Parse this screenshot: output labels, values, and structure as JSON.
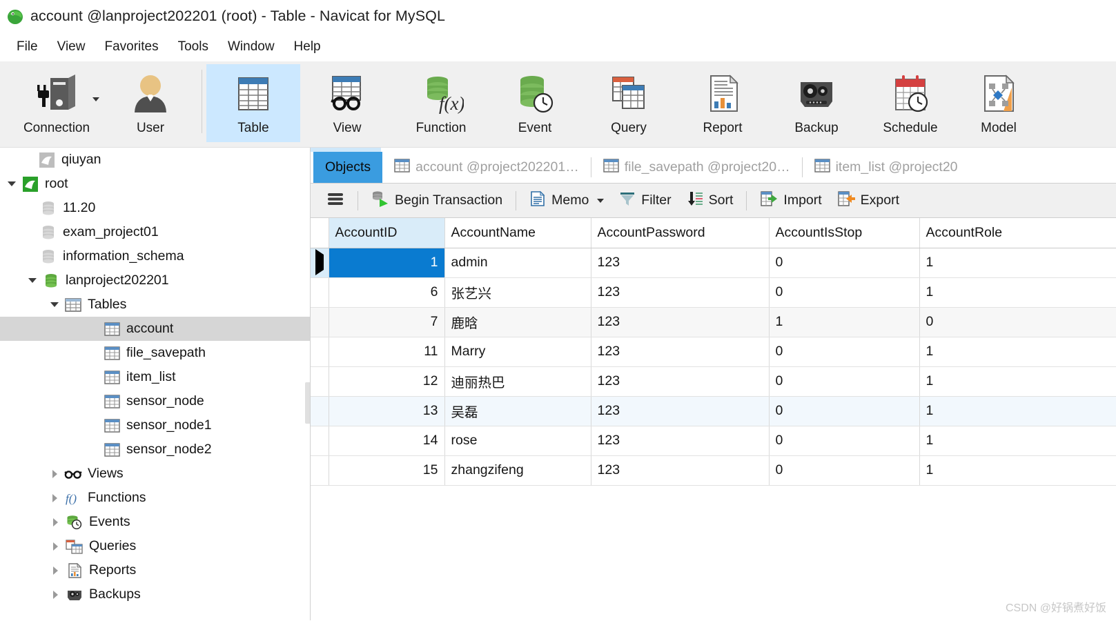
{
  "window": {
    "title": "account @lanproject202201 (root) - Table - Navicat for MySQL",
    "logo_icon": "navicat-dolphin-logo"
  },
  "menubar": {
    "items": [
      {
        "label": "File"
      },
      {
        "label": "View"
      },
      {
        "label": "Favorites"
      },
      {
        "label": "Tools"
      },
      {
        "label": "Window"
      },
      {
        "label": "Help"
      }
    ]
  },
  "ribbon": {
    "buttons": [
      {
        "label": "Connection",
        "icon": "connection-plug-icon",
        "has_dropdown": true,
        "active": false
      },
      {
        "label": "User",
        "icon": "user-icon",
        "has_dropdown": false,
        "active": false
      },
      {
        "label": "Table",
        "icon": "table-icon",
        "has_dropdown": false,
        "active": true
      },
      {
        "label": "View",
        "icon": "view-glasses-icon",
        "has_dropdown": false,
        "active": false
      },
      {
        "label": "Function",
        "icon": "function-fx-icon",
        "has_dropdown": false,
        "active": false
      },
      {
        "label": "Event",
        "icon": "event-clock-icon",
        "has_dropdown": false,
        "active": false
      },
      {
        "label": "Query",
        "icon": "query-icon",
        "has_dropdown": false,
        "active": false
      },
      {
        "label": "Report",
        "icon": "report-icon",
        "has_dropdown": false,
        "active": false
      },
      {
        "label": "Backup",
        "icon": "backup-tape-icon",
        "has_dropdown": false,
        "active": false
      },
      {
        "label": "Schedule",
        "icon": "schedule-calendar-icon",
        "has_dropdown": false,
        "active": false
      },
      {
        "label": "Model",
        "icon": "model-diagram-icon",
        "has_dropdown": false,
        "active": false
      }
    ]
  },
  "sidebar": {
    "nodes": [
      {
        "label": "qiuyan",
        "icon": "mysql-connection-gray-icon",
        "indent": 1,
        "twisty": "none",
        "selected": false
      },
      {
        "label": "root",
        "icon": "mysql-connection-green-icon",
        "indent": 0,
        "twisty": "down",
        "selected": false
      },
      {
        "label": "11.20",
        "icon": "database-gray-icon",
        "indent": 2,
        "twisty": "none",
        "selected": false
      },
      {
        "label": "exam_project01",
        "icon": "database-gray-icon",
        "indent": 2,
        "twisty": "none",
        "selected": false
      },
      {
        "label": "information_schema",
        "icon": "database-gray-icon",
        "indent": 2,
        "twisty": "none",
        "selected": false
      },
      {
        "label": "lanproject202201",
        "icon": "database-green-icon",
        "indent": 1,
        "twisty": "down",
        "selected": false
      },
      {
        "label": "Tables",
        "icon": "tables-folder-icon",
        "indent": 2,
        "twisty": "down",
        "selected": false
      },
      {
        "label": "account",
        "icon": "table-icon",
        "indent": 4,
        "twisty": "none",
        "selected": true
      },
      {
        "label": "file_savepath",
        "icon": "table-icon",
        "indent": 4,
        "twisty": "none",
        "selected": false
      },
      {
        "label": "item_list",
        "icon": "table-icon",
        "indent": 4,
        "twisty": "none",
        "selected": false
      },
      {
        "label": "sensor_node",
        "icon": "table-icon",
        "indent": 4,
        "twisty": "none",
        "selected": false
      },
      {
        "label": "sensor_node1",
        "icon": "table-icon",
        "indent": 4,
        "twisty": "none",
        "selected": false
      },
      {
        "label": "sensor_node2",
        "icon": "table-icon",
        "indent": 4,
        "twisty": "none",
        "selected": false
      },
      {
        "label": "Views",
        "icon": "view-glasses-icon",
        "indent": 2,
        "twisty": "right",
        "selected": false
      },
      {
        "label": "Functions",
        "icon": "function-fx-icon",
        "indent": 2,
        "twisty": "right",
        "selected": false
      },
      {
        "label": "Events",
        "icon": "event-clock-icon",
        "indent": 2,
        "twisty": "right",
        "selected": false
      },
      {
        "label": "Queries",
        "icon": "query-icon",
        "indent": 2,
        "twisty": "right",
        "selected": false
      },
      {
        "label": "Reports",
        "icon": "report-icon",
        "indent": 2,
        "twisty": "right",
        "selected": false
      },
      {
        "label": "Backups",
        "icon": "backup-tape-icon",
        "indent": 2,
        "twisty": "right",
        "selected": false
      }
    ]
  },
  "tabs": [
    {
      "label": "Objects",
      "icon": null,
      "active": true
    },
    {
      "label": "account @project202201…",
      "icon": "table-icon",
      "active": false
    },
    {
      "label": "file_savepath @project20…",
      "icon": "table-icon",
      "active": false
    },
    {
      "label": "item_list @project20",
      "icon": "table-icon",
      "active": false
    }
  ],
  "grid_toolbar": {
    "items": [
      {
        "label": "",
        "icon": "hamburger-menu-icon",
        "dropdown": false
      },
      {
        "label": "Begin Transaction",
        "icon": "begin-transaction-icon",
        "dropdown": false
      },
      {
        "label": "Memo",
        "icon": "memo-icon",
        "dropdown": true
      },
      {
        "label": "Filter",
        "icon": "filter-funnel-icon",
        "dropdown": false
      },
      {
        "label": "Sort",
        "icon": "sort-icon",
        "dropdown": false
      },
      {
        "label": "Import",
        "icon": "import-icon",
        "dropdown": false
      },
      {
        "label": "Export",
        "icon": "export-icon",
        "dropdown": false
      }
    ]
  },
  "table_data": {
    "columns": [
      "AccountID",
      "AccountName",
      "AccountPassword",
      "AccountIsStop",
      "AccountRole"
    ],
    "active_column": "AccountID",
    "current_row_index": 0,
    "selected_cell": {
      "row": 0,
      "column": "AccountID"
    },
    "rows": [
      {
        "AccountID": "1",
        "AccountName": "admin",
        "AccountPassword": "123",
        "AccountIsStop": "0",
        "AccountRole": "1"
      },
      {
        "AccountID": "6",
        "AccountName": "张艺兴",
        "AccountPassword": "123",
        "AccountIsStop": "0",
        "AccountRole": "1"
      },
      {
        "AccountID": "7",
        "AccountName": "鹿晗",
        "AccountPassword": "123",
        "AccountIsStop": "1",
        "AccountRole": "0"
      },
      {
        "AccountID": "11",
        "AccountName": "Marry",
        "AccountPassword": "123",
        "AccountIsStop": "0",
        "AccountRole": "1"
      },
      {
        "AccountID": "12",
        "AccountName": "迪丽热巴",
        "AccountPassword": "123",
        "AccountIsStop": "0",
        "AccountRole": "1"
      },
      {
        "AccountID": "13",
        "AccountName": "吴磊",
        "AccountPassword": "123",
        "AccountIsStop": "0",
        "AccountRole": "1"
      },
      {
        "AccountID": "14",
        "AccountName": "rose",
        "AccountPassword": "123",
        "AccountIsStop": "0",
        "AccountRole": "1"
      },
      {
        "AccountID": "15",
        "AccountName": "zhangzifeng",
        "AccountPassword": "123",
        "AccountIsStop": "0",
        "AccountRole": "1"
      }
    ]
  },
  "watermark": {
    "text": "CSDN @好锅煮好饭"
  },
  "colors": {
    "accent_blue": "#3a9ce0",
    "selected_cell_blue": "#0a7bd0",
    "ribbon_active_blue": "#cce8ff",
    "key_column_blue": "#d9ecf9",
    "tree_selection_gray": "#d6d6d6",
    "toolbar_gray": "#f0f0f0"
  }
}
